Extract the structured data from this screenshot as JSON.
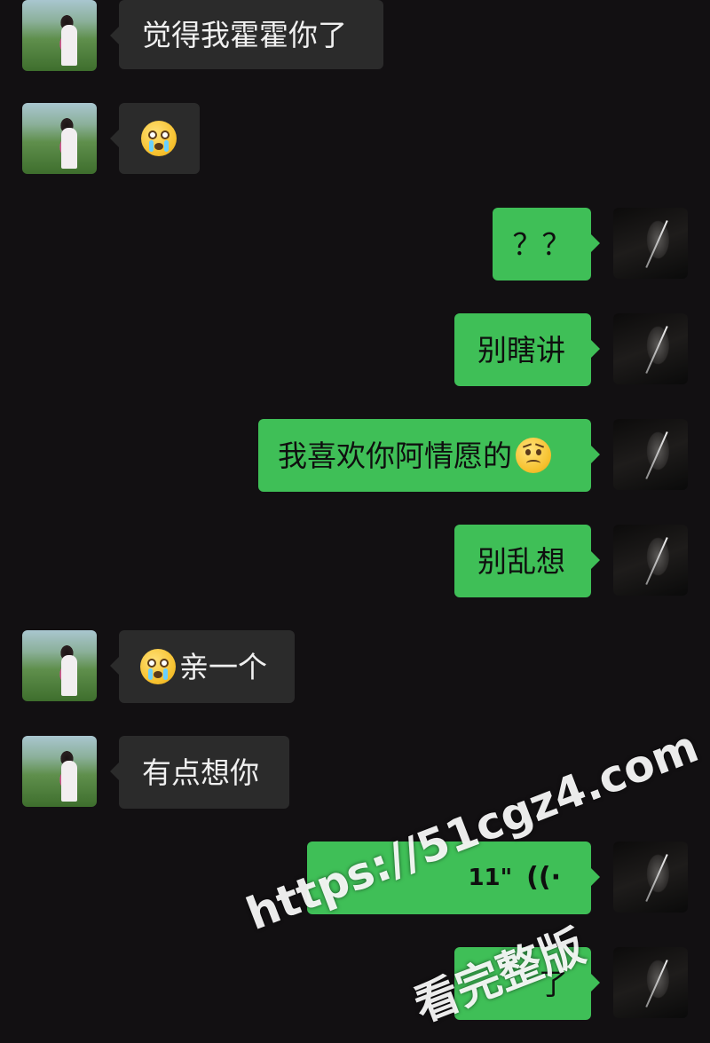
{
  "messages": [
    {
      "side": "in",
      "text": "觉得我霍霍你了"
    },
    {
      "side": "in",
      "emoji": "pleading-crying-face-icon"
    },
    {
      "side": "out",
      "text": "？？"
    },
    {
      "side": "out",
      "text": "别瞎讲"
    },
    {
      "side": "out",
      "text": "我喜欢你阿情愿的",
      "emoji": "frowning-face-icon"
    },
    {
      "side": "out",
      "text": "别乱想"
    },
    {
      "side": "in",
      "text": "亲一个",
      "emoji": "pleading-crying-face-icon"
    },
    {
      "side": "in",
      "text": "有点想你"
    },
    {
      "side": "out",
      "voice_duration": "11\"",
      "icon": "voice-wave-icon"
    },
    {
      "side": "out",
      "text": "了"
    }
  ],
  "colors": {
    "background": "#121012",
    "incoming_bubble": "#2b2b2b",
    "outgoing_bubble": "#3fbf57"
  },
  "watermark": {
    "url": "https://51cgz4.com",
    "label": "看完整版"
  }
}
